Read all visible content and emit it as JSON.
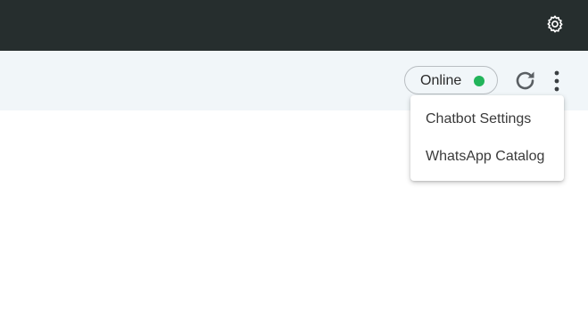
{
  "header": {
    "settings_icon": "gear-icon"
  },
  "toolbar": {
    "status_label": "Online",
    "status_color": "#22b45a",
    "refresh_icon": "refresh-icon",
    "more_icon": "more-vertical-icon"
  },
  "menu": {
    "items": [
      {
        "label": "Chatbot Settings"
      },
      {
        "label": "WhatsApp Catalog"
      }
    ]
  },
  "colors": {
    "topbar": "#262e2e",
    "toolbar": "#f1f6f9"
  }
}
